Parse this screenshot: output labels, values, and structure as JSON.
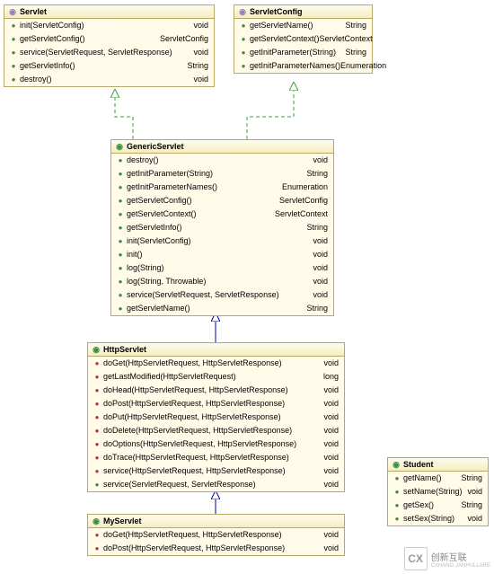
{
  "servlet": {
    "title": "Servlet",
    "methods": [
      {
        "sig": "init(ServletConfig)",
        "ret": "void"
      },
      {
        "sig": "getServletConfig()",
        "ret": "ServletConfig"
      },
      {
        "sig": "service(ServletRequest, ServletResponse)",
        "ret": "void"
      },
      {
        "sig": "getServletInfo()",
        "ret": "String"
      },
      {
        "sig": "destroy()",
        "ret": "void"
      }
    ]
  },
  "servletConfig": {
    "title": "ServletConfig",
    "methods": [
      {
        "sig": "getServletName()",
        "ret": "String"
      },
      {
        "sig": "getServletContext()",
        "ret": "ServletContext"
      },
      {
        "sig": "getInitParameter(String)",
        "ret": "String"
      },
      {
        "sig": "getInitParameterNames()",
        "ret": "Enumeration"
      }
    ]
  },
  "genericServlet": {
    "title": "GenericServlet",
    "methods": [
      {
        "sig": "destroy()",
        "ret": "void"
      },
      {
        "sig": "getInitParameter(String)",
        "ret": "String"
      },
      {
        "sig": "getInitParameterNames()",
        "ret": "Enumeration"
      },
      {
        "sig": "getServletConfig()",
        "ret": "ServletConfig"
      },
      {
        "sig": "getServletContext()",
        "ret": "ServletContext"
      },
      {
        "sig": "getServletInfo()",
        "ret": "String"
      },
      {
        "sig": "init(ServletConfig)",
        "ret": "void"
      },
      {
        "sig": "init()",
        "ret": "void"
      },
      {
        "sig": "log(String)",
        "ret": "void"
      },
      {
        "sig": "log(String, Throwable)",
        "ret": "void"
      },
      {
        "sig": "service(ServletRequest, ServletResponse)",
        "ret": "void"
      },
      {
        "sig": "getServletName()",
        "ret": "String"
      }
    ]
  },
  "httpServlet": {
    "title": "HttpServlet",
    "methods": [
      {
        "sig": "doGet(HttpServletRequest, HttpServletResponse)",
        "ret": "void",
        "red": true
      },
      {
        "sig": "getLastModified(HttpServletRequest)",
        "ret": "long",
        "red": true
      },
      {
        "sig": "doHead(HttpServletRequest, HttpServletResponse)",
        "ret": "void",
        "red": true
      },
      {
        "sig": "doPost(HttpServletRequest, HttpServletResponse)",
        "ret": "void",
        "red": true
      },
      {
        "sig": "doPut(HttpServletRequest, HttpServletResponse)",
        "ret": "void",
        "red": true
      },
      {
        "sig": "doDelete(HttpServletRequest, HttpServletResponse)",
        "ret": "void",
        "red": true
      },
      {
        "sig": "doOptions(HttpServletRequest, HttpServletResponse)",
        "ret": "void",
        "red": true
      },
      {
        "sig": "doTrace(HttpServletRequest, HttpServletResponse)",
        "ret": "void",
        "red": true
      },
      {
        "sig": "service(HttpServletRequest, HttpServletResponse)",
        "ret": "void",
        "red": true
      },
      {
        "sig": "service(ServletRequest, ServletResponse)",
        "ret": "void"
      }
    ]
  },
  "myServlet": {
    "title": "MyServlet",
    "methods": [
      {
        "sig": "doGet(HttpServletRequest, HttpServletResponse)",
        "ret": "void",
        "red": true
      },
      {
        "sig": "doPost(HttpServletRequest, HttpServletResponse)",
        "ret": "void",
        "red": true
      }
    ]
  },
  "student": {
    "title": "Student",
    "methods": [
      {
        "sig": "getName()",
        "ret": "String"
      },
      {
        "sig": "setName(String)",
        "ret": "void"
      },
      {
        "sig": "getSex()",
        "ret": "String"
      },
      {
        "sig": "setSex(String)",
        "ret": "void"
      }
    ]
  },
  "watermark": {
    "text": "创新互联",
    "sub": "CXHANG JANHULLARE"
  }
}
